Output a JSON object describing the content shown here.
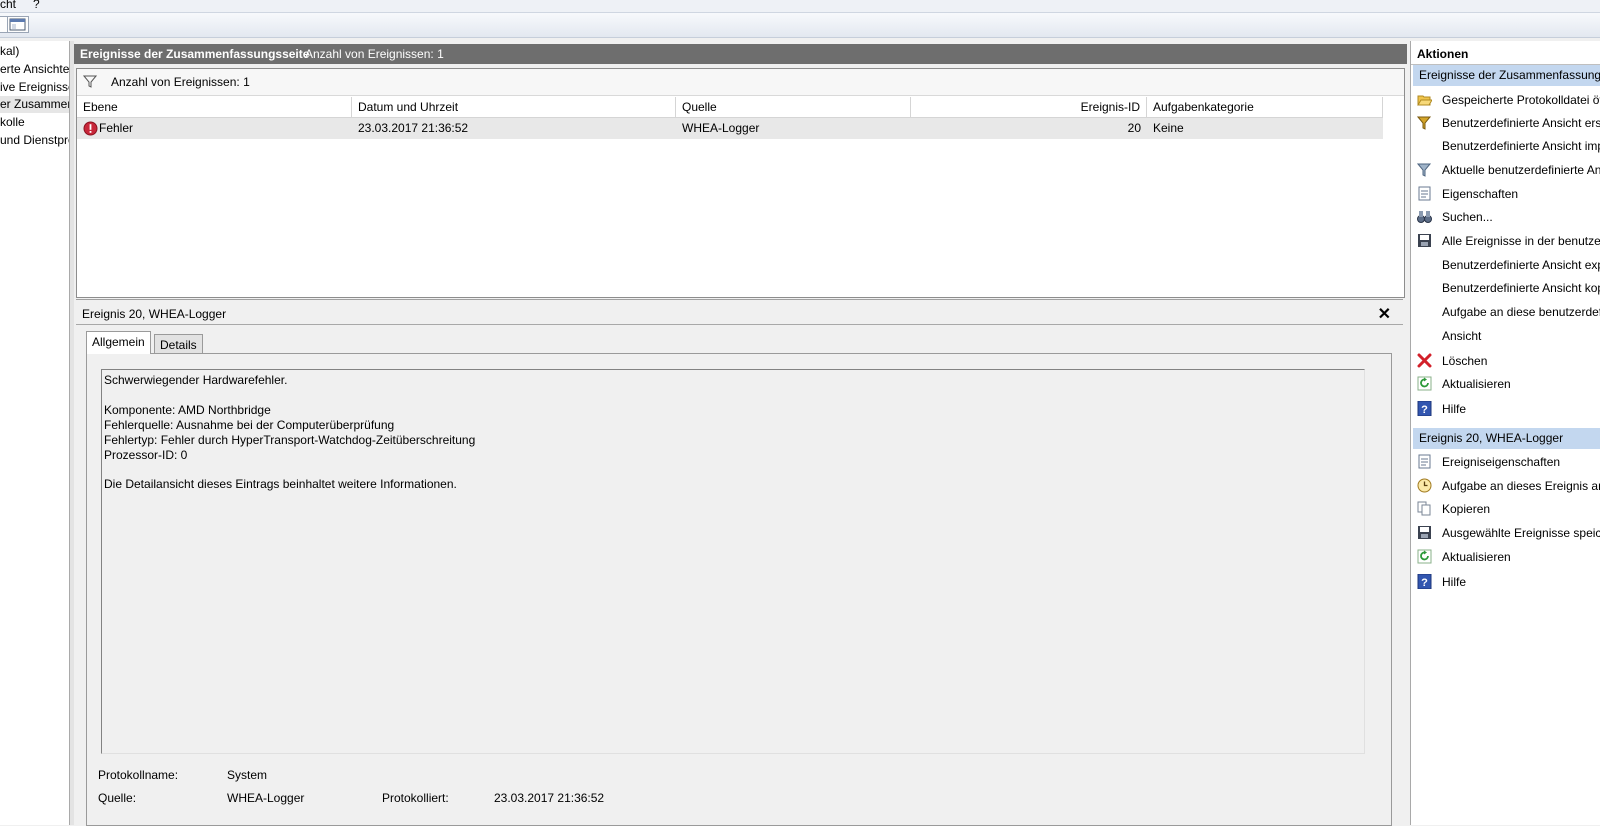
{
  "menu": {
    "items": [
      "cht",
      "?"
    ]
  },
  "tree": {
    "items": [
      {
        "label": "kal)",
        "selected": false
      },
      {
        "label": "erte Ansichten",
        "selected": false
      },
      {
        "label": "ive Ereignisse",
        "selected": false
      },
      {
        "label": "er Zusammenfa",
        "selected": true
      },
      {
        "label": "kolle",
        "selected": false
      },
      {
        "label": "und Dienstpro",
        "selected": false
      }
    ]
  },
  "summary": {
    "title": "Ereignisse der Zusammenfassungsseite",
    "count": "Anzahl von Ereignissen: 1",
    "filter_count": "Anzahl von Ereignissen: 1"
  },
  "table": {
    "columns": [
      "Ebene",
      "Datum und Uhrzeit",
      "Quelle",
      "Ereignis-ID",
      "Aufgabenkategorie"
    ],
    "rows": [
      {
        "level": "Fehler",
        "datetime": "23.03.2017 21:36:52",
        "source": "WHEA-Logger",
        "event_id": "20",
        "category": "Keine"
      }
    ]
  },
  "detail": {
    "title": "Ereignis 20, WHEA-Logger",
    "close_glyph": "✕",
    "tabs": [
      "Allgemein",
      "Details"
    ],
    "message": {
      "line1": "Schwerwiegender Hardwarefehler.",
      "line2": "Komponente: AMD Northbridge",
      "line3": "Fehlerquelle: Ausnahme bei der Computerüberprüfung",
      "line4": "Fehlertyp: Fehler durch HyperTransport-Watchdog-Zeitüberschreitung",
      "line5": "Prozessor-ID: 0",
      "line6": "Die Detailansicht dieses Eintrags beinhaltet weitere Informationen."
    },
    "fields": {
      "log_name_label": "Protokollname:",
      "log_name_value": "System",
      "source_label": "Quelle:",
      "source_value": "WHEA-Logger",
      "logged_label": "Protokolliert:",
      "logged_value": "23.03.2017 21:36:52"
    }
  },
  "actions": {
    "header": "Aktionen",
    "section1": {
      "title": "Ereignisse der Zusammenfassungsseite",
      "items": [
        {
          "label": "Gespeicherte Protokolldatei öffnen...",
          "icon": "folder-open-icon"
        },
        {
          "label": "Benutzerdefinierte Ansicht erstellen...",
          "icon": "filter-add-icon"
        },
        {
          "label": "Benutzerdefinierte Ansicht importieren...",
          "icon": ""
        },
        {
          "label": "Aktuelle benutzerdefinierte Ansicht filtern...",
          "icon": "filter-icon"
        },
        {
          "label": "Eigenschaften",
          "icon": "properties-icon"
        },
        {
          "label": "Suchen...",
          "icon": "binoculars-icon"
        },
        {
          "label": "Alle Ereignisse in der benutzerdefinierten Ansicht speichern unter...",
          "icon": "save-icon"
        },
        {
          "label": "Benutzerdefinierte Ansicht exportieren...",
          "icon": ""
        },
        {
          "label": "Benutzerdefinierte Ansicht kopieren...",
          "icon": ""
        },
        {
          "label": "Aufgabe an diese benutzerdefinierte Ansicht anfügen...",
          "icon": ""
        },
        {
          "label": "Ansicht",
          "icon": ""
        },
        {
          "label": "Löschen",
          "icon": "delete-icon"
        },
        {
          "label": "Aktualisieren",
          "icon": "refresh-icon"
        },
        {
          "label": "Hilfe",
          "icon": "help-icon"
        }
      ]
    },
    "section2": {
      "title": "Ereignis 20, WHEA-Logger",
      "items": [
        {
          "label": "Ereigniseigenschaften",
          "icon": "properties-icon"
        },
        {
          "label": "Aufgabe an dieses Ereignis anfügen...",
          "icon": "task-clock-icon"
        },
        {
          "label": "Kopieren",
          "icon": "copy-icon"
        },
        {
          "label": "Ausgewählte Ereignisse speichern...",
          "icon": "save-icon"
        },
        {
          "label": "Aktualisieren",
          "icon": "refresh-icon"
        },
        {
          "label": "Hilfe",
          "icon": "help-icon"
        }
      ]
    }
  }
}
